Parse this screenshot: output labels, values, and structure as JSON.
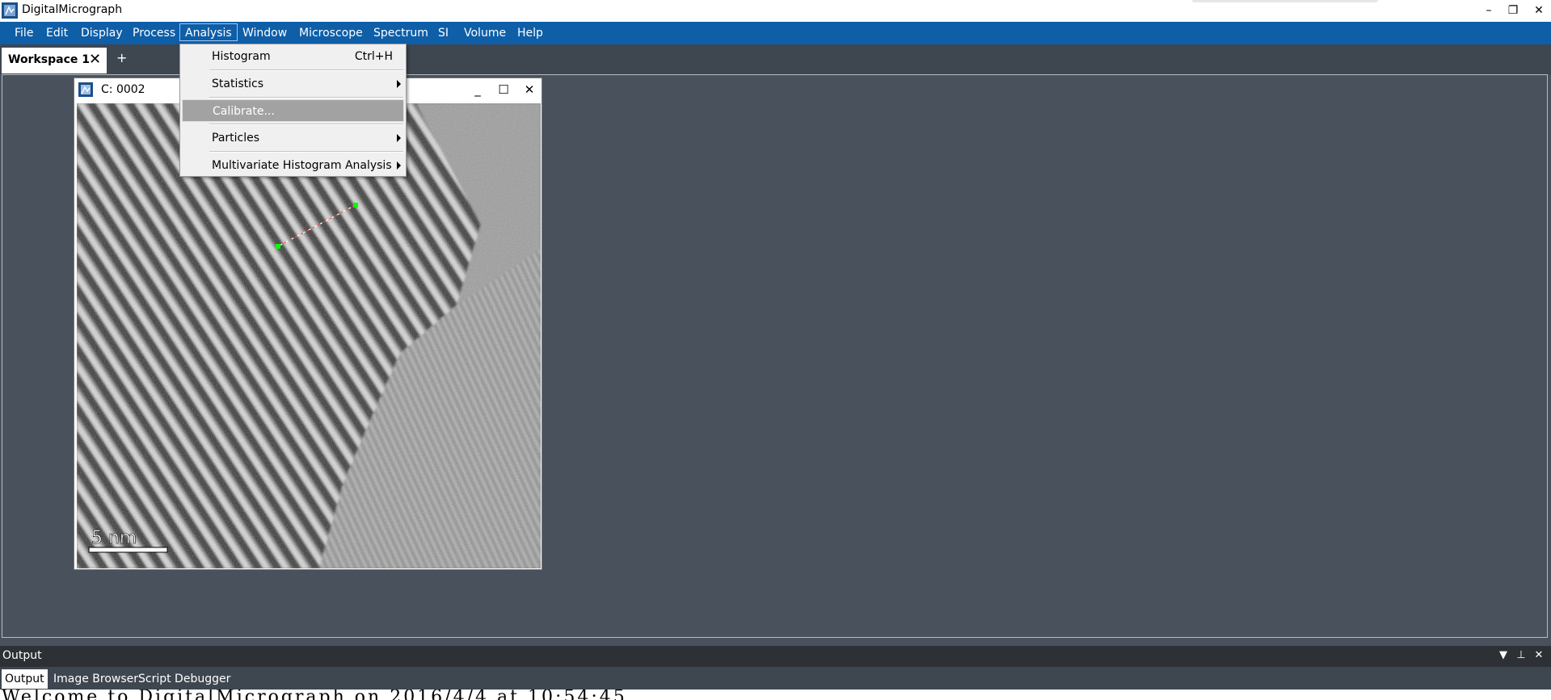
{
  "app": {
    "title": "DigitalMicrograph",
    "window_controls": {
      "minimize": "–",
      "restore": "❐",
      "close": "✕"
    }
  },
  "menubar": {
    "items": [
      "File",
      "Edit",
      "Display",
      "Process",
      "Analysis",
      "Window",
      "Microscope",
      "Spectrum",
      "SI",
      "Volume",
      "Help"
    ],
    "active": "Analysis"
  },
  "analysis_menu": {
    "items": [
      {
        "label": "Histogram",
        "shortcut": "Ctrl+H",
        "submenu": false,
        "highlighted": false
      },
      {
        "label": "Statistics",
        "shortcut": "",
        "submenu": true,
        "highlighted": false
      },
      {
        "label": "Calibrate...",
        "shortcut": "",
        "submenu": false,
        "highlighted": true
      },
      {
        "label": "Particles",
        "shortcut": "",
        "submenu": true,
        "highlighted": false
      },
      {
        "label": "Multivariate Histogram Analysis",
        "shortcut": "",
        "submenu": true,
        "highlighted": false
      }
    ]
  },
  "workspace": {
    "tab_label": "Workspace 1",
    "close_glyph": "✕",
    "add_glyph": "+"
  },
  "image_window": {
    "title": "C: 0002",
    "controls": {
      "minimize": "_",
      "maximize": "☐",
      "close": "✕"
    },
    "scale_bar_label": "5  nm",
    "line_roi_color": "#ff4a4a",
    "handle_color": "#00ff00"
  },
  "output_panel": {
    "title": "Output",
    "controls": {
      "menu": "▼",
      "pin": "⊥",
      "close": "✕"
    },
    "tabs": [
      "Output",
      "Image Browser",
      "Script Debugger"
    ],
    "active_tab": "Output",
    "text_line": "Welcome to DigitalMicrograph on 2016/4/4 at 10:54:45"
  },
  "colors": {
    "menubar_bg": "#0e5ea8",
    "workspace_bg": "#49525c",
    "menu_highlight": "#a2a2a2"
  }
}
